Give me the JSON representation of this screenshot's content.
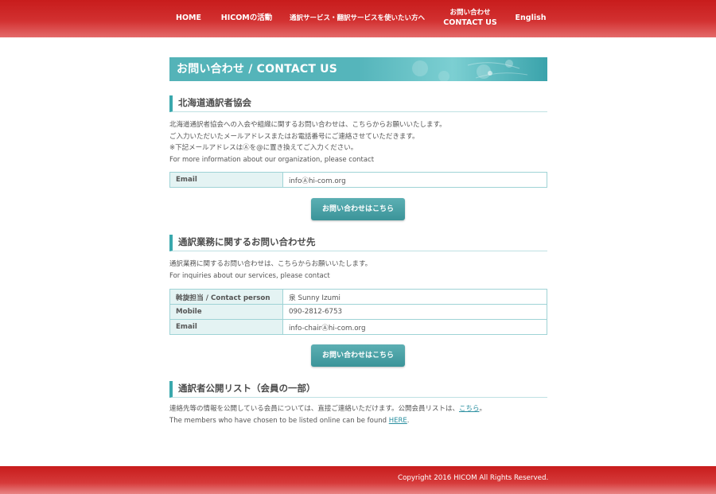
{
  "nav": {
    "home": "HOME",
    "activities": "HICOMの活動",
    "services": "通訳サービス・翻訳サービスを使いたい方へ",
    "contact_jp": "お問い合わせ",
    "contact_en": "CONTACT US",
    "english": "English"
  },
  "banner": {
    "title": "お問い合わせ / CONTACT US"
  },
  "section1": {
    "heading": "北海道通訳者協会",
    "lines": [
      "北海道通訳者協会への入会や組織に関するお問い合わせは、こちらからお願いいたします。",
      "ご入力いただいたメールアドレスまたはお電話番号にご連絡させていただきます。",
      "※下記メールアドレスはⒶを@に置き換えてご入力ください。",
      "For more information about our organization, please contact"
    ],
    "table": [
      {
        "key": "Email",
        "value": "infoⒶhi-com.org"
      }
    ],
    "button": "お問い合わせはこちら"
  },
  "section2": {
    "heading": "通訳業務に関するお問い合わせ先",
    "lines": [
      "通訳業務に関するお問い合わせは、こちらからお願いいたします。",
      "For inquiries about our services, please contact"
    ],
    "table": [
      {
        "key": "斡旋担当 / Contact person",
        "value": "泉 Sunny Izumi"
      },
      {
        "key": "Mobile",
        "value": "090-2812-6753"
      },
      {
        "key": "Email",
        "value": "info-chairⒶhi-com.org"
      }
    ],
    "button": "お問い合わせはこちら"
  },
  "section3": {
    "heading": "通訳者公開リスト（会員の一部）",
    "line1_text": "連絡先等の情報を公開している会員については、直接ご連絡いただけます。公開会員リストは、",
    "line1_link": "こちら",
    "line1_end": "。",
    "line2_text": "The members who have chosen to be listed online can be found ",
    "line2_link": "HERE",
    "line2_end": "."
  },
  "footer": {
    "copyright": "Copyright 2016 HICOM All Rights Reserved."
  },
  "colors": {
    "nav_red": "#c81c1c",
    "teal": "#3aa8ad",
    "table_key_bg": "#e4f3f3"
  }
}
